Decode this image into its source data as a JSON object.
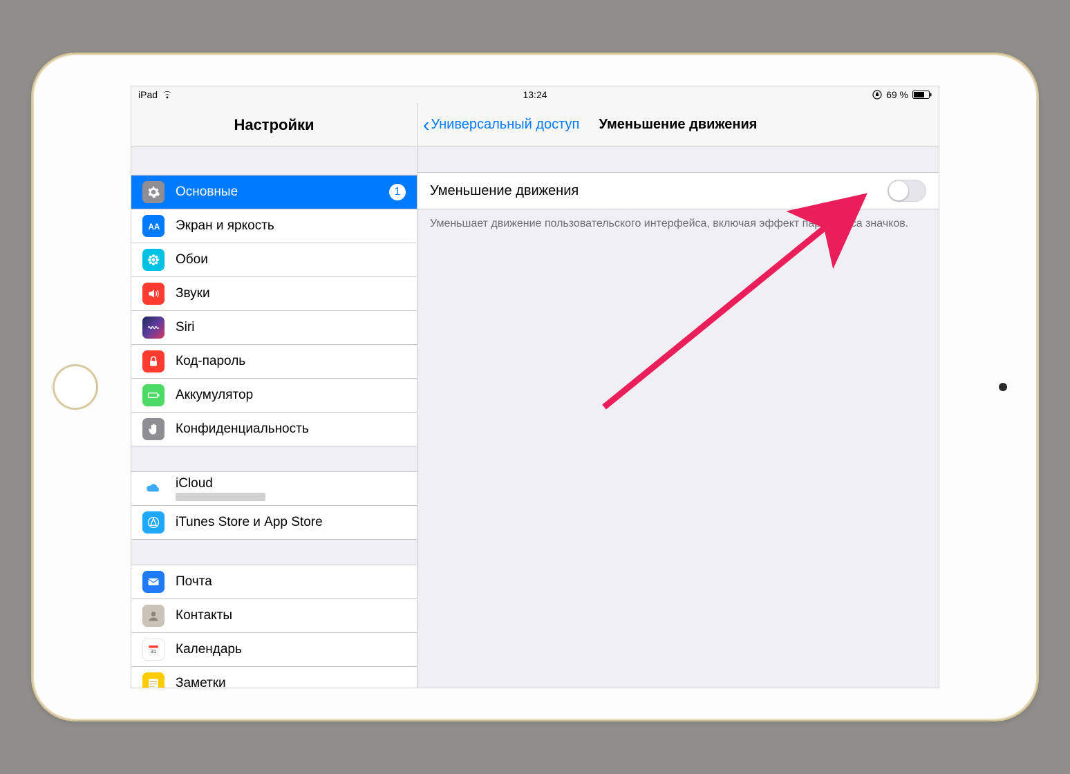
{
  "status": {
    "device": "iPad",
    "time": "13:24",
    "battery_text": "69 %"
  },
  "sidebar": {
    "title": "Настройки",
    "groups": [
      [
        {
          "label": "Основные",
          "badge": "1",
          "selected": true,
          "icon": "gear"
        },
        {
          "label": "Экран и яркость",
          "icon": "aa"
        },
        {
          "label": "Обои",
          "icon": "flower"
        },
        {
          "label": "Звуки",
          "icon": "speaker"
        },
        {
          "label": "Siri",
          "icon": "siri"
        },
        {
          "label": "Код-пароль",
          "icon": "lock"
        },
        {
          "label": "Аккумулятор",
          "icon": "battery"
        },
        {
          "label": "Конфиденциальность",
          "icon": "hand"
        }
      ],
      [
        {
          "label": "iCloud",
          "icon": "cloud",
          "sub": true
        },
        {
          "label": "iTunes Store и App Store",
          "icon": "appstore"
        }
      ],
      [
        {
          "label": "Почта",
          "icon": "mail"
        },
        {
          "label": "Контакты",
          "icon": "contacts"
        },
        {
          "label": "Календарь",
          "icon": "calendar"
        },
        {
          "label": "Заметки",
          "icon": "notes"
        }
      ]
    ]
  },
  "detail": {
    "back_label": "Универсальный доступ",
    "title": "Уменьшение движения",
    "row_label": "Уменьшение движения",
    "footnote": "Уменьшает движение пользовательского интерфейса, включая эффект параллакса значков."
  }
}
